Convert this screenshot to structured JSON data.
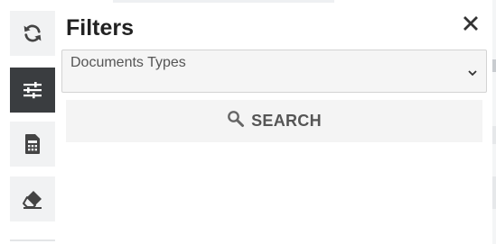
{
  "rail": {
    "items": [
      {
        "icon": "refresh-icon",
        "active": false
      },
      {
        "icon": "sliders-icon",
        "active": true
      },
      {
        "icon": "calculator-icon",
        "active": false
      },
      {
        "icon": "eraser-icon",
        "active": false
      }
    ]
  },
  "panel": {
    "title": "Filters",
    "close_icon": "close-icon",
    "document_type_select": {
      "placeholder": "Documents Types",
      "icon": "chevron-down-icon"
    },
    "search_button": {
      "label": "SEARCH",
      "icon": "search-icon"
    }
  },
  "colors": {
    "active_rail": "#3a3d40",
    "rail_button": "#f1f2f3",
    "icon_dark": "#444444",
    "button_bg": "#f4f4f4",
    "button_text": "#555555"
  }
}
